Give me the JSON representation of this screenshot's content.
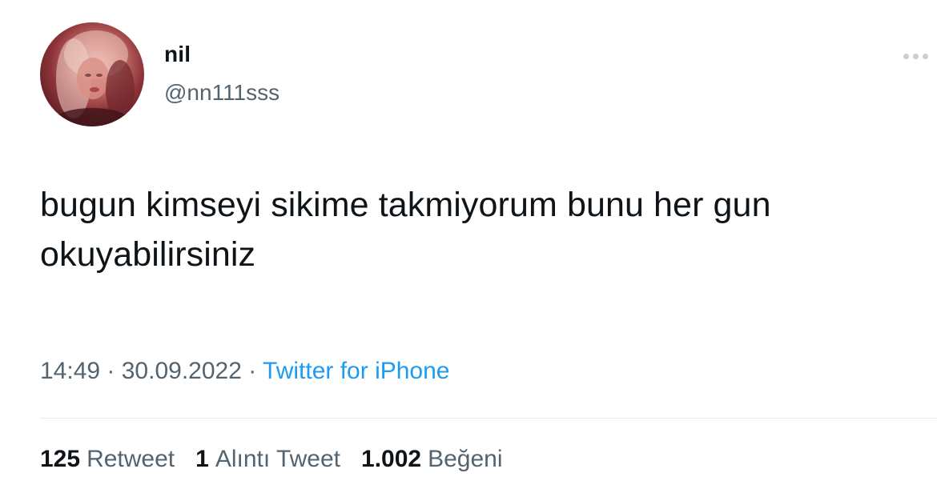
{
  "tweet": {
    "author_name": "nil",
    "author_handle": "@nn111sss",
    "avatar_icon": "profile-photo",
    "more_icon": "ellipsis-icon",
    "text": "bugun kimseyi sikime takmiyorum bunu her gun okuyabilirsiniz",
    "time": "14:49",
    "separator": "·",
    "date": "30.09.2022",
    "source": "Twitter for iPhone",
    "stats": {
      "retweets_count": "125",
      "retweets_label": "Retweet",
      "quotes_count": "1",
      "quotes_label": "Alıntı Tweet",
      "likes_count": "1.002",
      "likes_label": "Beğeni"
    }
  },
  "colors": {
    "text_primary": "#0f1419",
    "text_secondary": "#536471",
    "link": "#1d9bf0",
    "divider": "#e6ecf0"
  }
}
